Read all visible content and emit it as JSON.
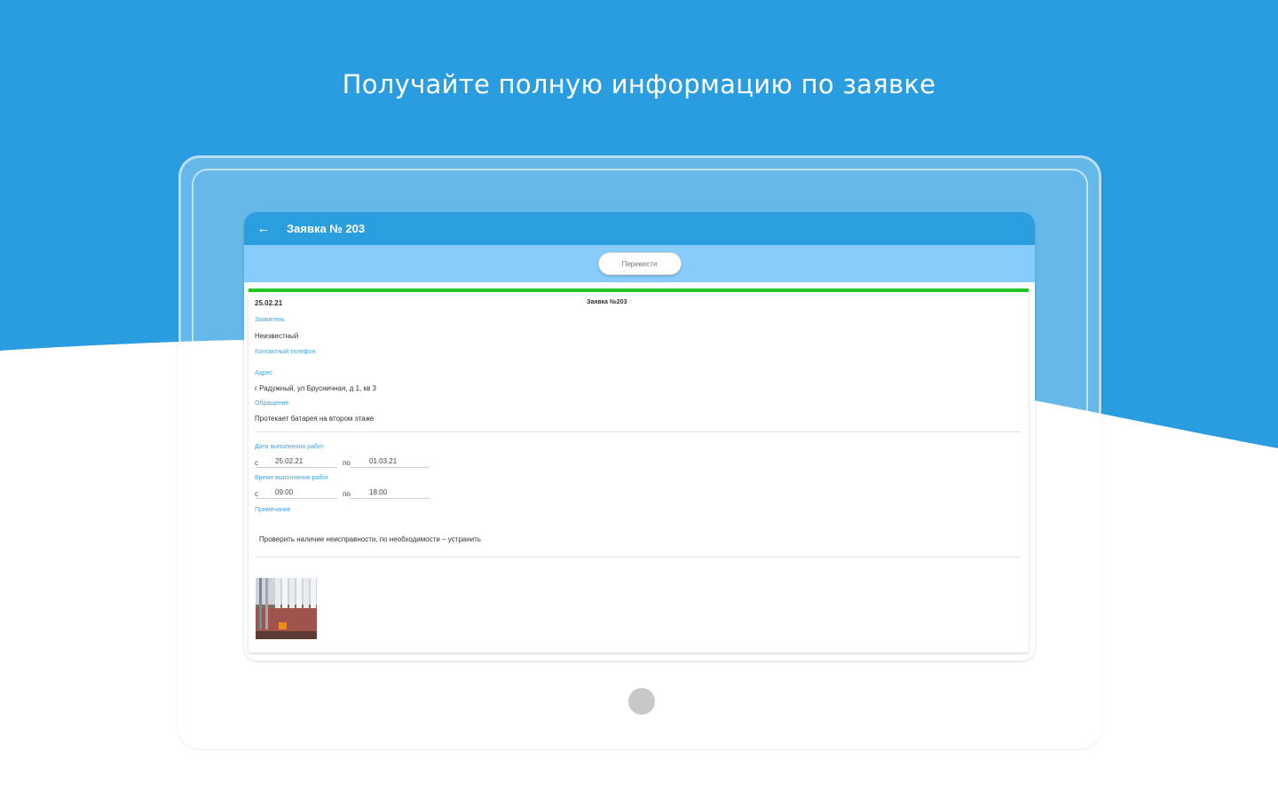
{
  "headline": "Получайте полную информацию по заявке",
  "colors": {
    "blue": "#2a9de0",
    "light_bg": "#eef3f6",
    "appbar": "#2b9ee0",
    "subbar": "#87cdfb",
    "accent_green": "#22c322",
    "label_blue": "#4aa3e0"
  },
  "appbar": {
    "back_icon": "arrow-left-icon",
    "title": "Заявка № 203"
  },
  "transfer_button": "Перевести",
  "card": {
    "date": "25.02.21",
    "request_number": "Заявка №203",
    "fields": [
      {
        "label": "Заявитель",
        "value": "Неизвестный"
      },
      {
        "label": "Контактный телефон",
        "value": ""
      },
      {
        "label": "Адрес",
        "value": "г Радужный, ул Брусничная, д 1, кв 3"
      },
      {
        "label": "Обращение",
        "value": "Протекает батарея на втором этаже"
      }
    ],
    "work_date_label": "Дата выполнения работ",
    "from_word": "с",
    "to_word": "по",
    "date_from": "25.02.21",
    "date_to": "01.03.21",
    "work_time_label": "Время выполнения работ",
    "time_from": "09:00",
    "time_to": "18:00",
    "note_label": "Примечание",
    "note_text": "Проверить наличие неисправности, по необходимости – устранить"
  }
}
